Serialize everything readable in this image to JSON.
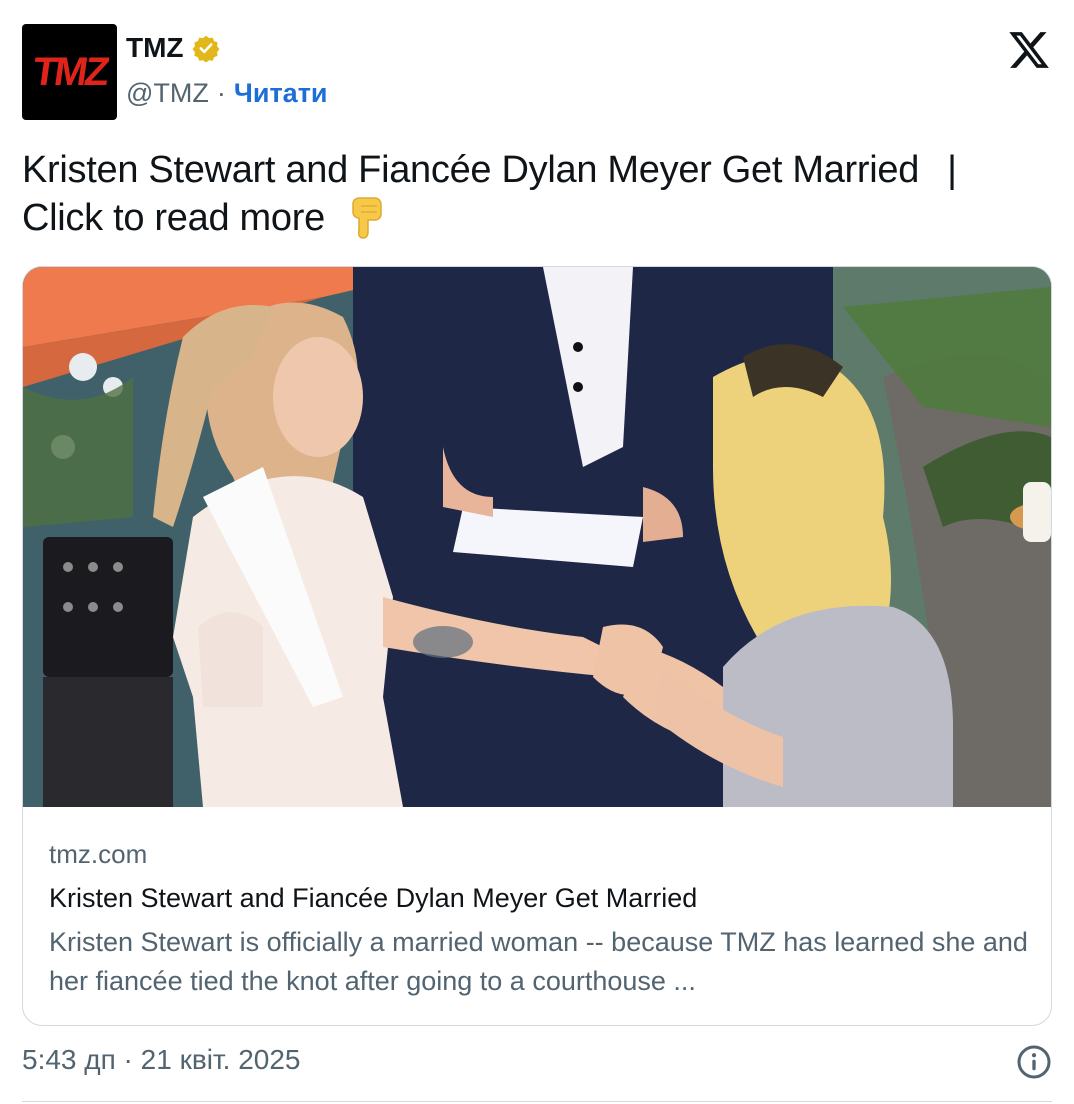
{
  "header": {
    "avatar_text": "TMZ",
    "name": "TMZ",
    "verified_icon": "gold-verified-badge-icon",
    "handle": "@TMZ",
    "separator": "·",
    "follow_label": "Читати",
    "platform_icon": "x-logo-icon"
  },
  "tweet": {
    "text_line1": "Kristen Stewart and Fiancée Dylan Meyer Get Married",
    "pipe": "|",
    "text_line2": "Click to read more",
    "emoji_icon": "pointing-down-hand-icon"
  },
  "card": {
    "image_icon": "wedding-photo-image",
    "domain": "tmz.com",
    "title": "Kristen Stewart and Fiancée Dylan Meyer Get Married",
    "description": "Kristen Stewart is officially a married woman -- because TMZ has learned she and her fiancée tied the knot after going to a courthouse ..."
  },
  "footer": {
    "timestamp": "5:43 дп · 21 квіт. 2025",
    "info_icon": "info-icon"
  },
  "colors": {
    "follow_blue": "#1d6fd6",
    "secondary_text": "#536471",
    "tmz_red": "#e0241b",
    "badge_gold": "#e2b719"
  }
}
